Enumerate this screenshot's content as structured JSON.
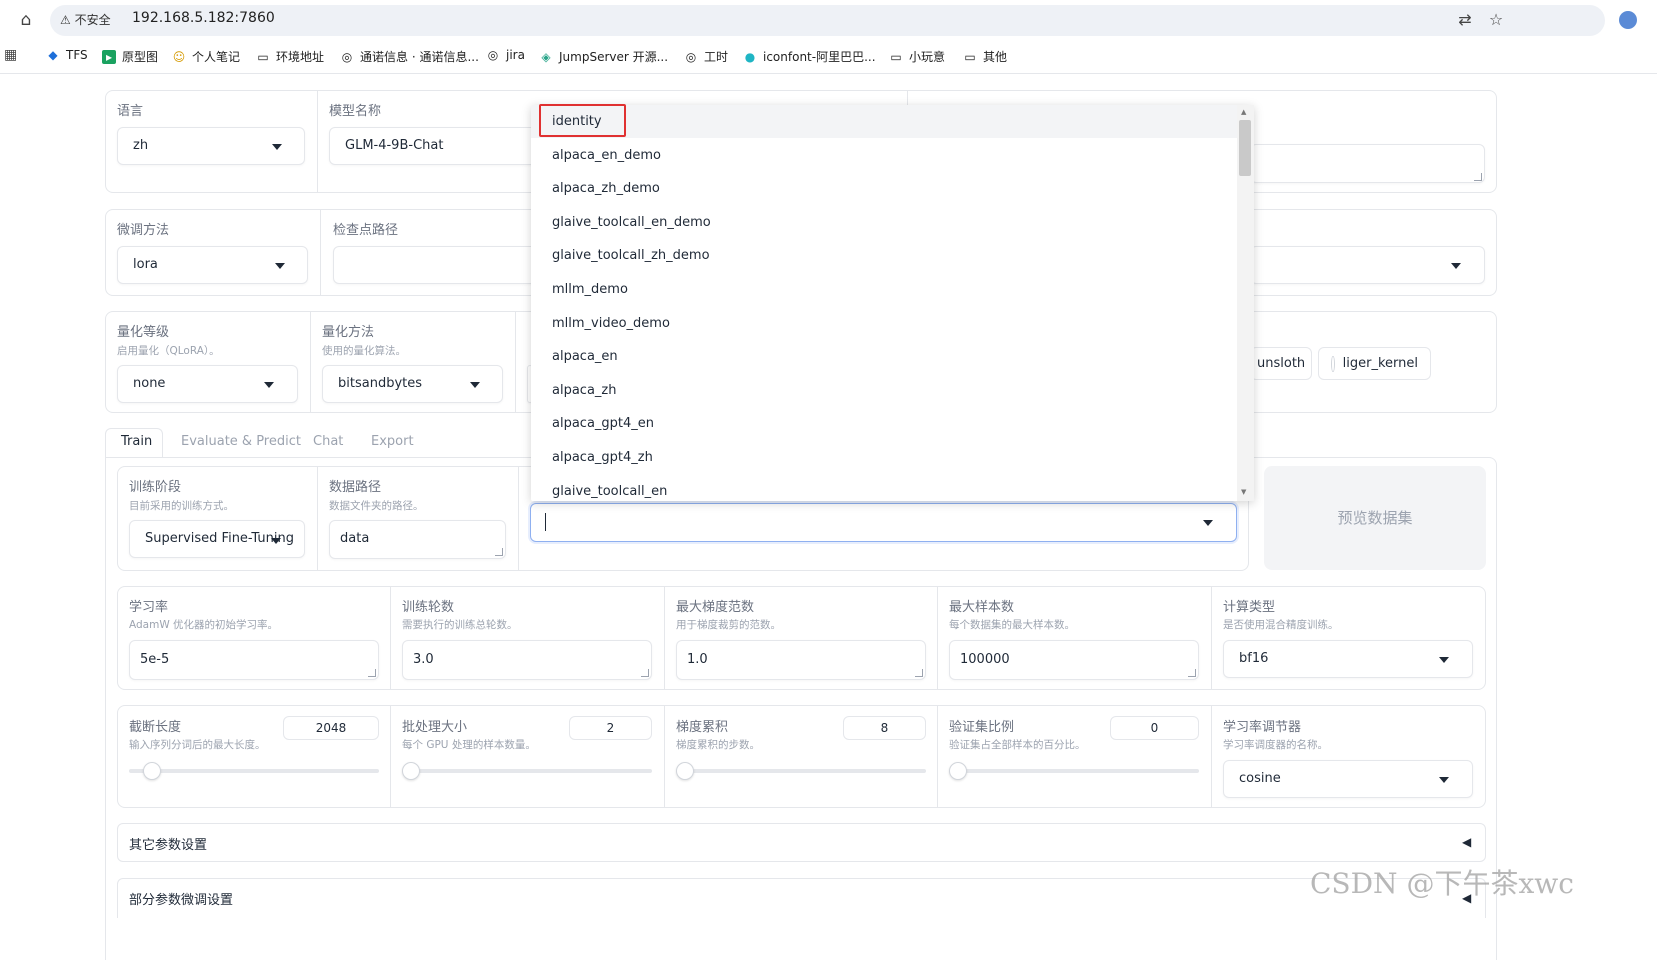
{
  "browser": {
    "insecure_label": "不安全",
    "url": "192.168.5.182:7860",
    "bookmarks": [
      {
        "label": "TFS",
        "icon": "azure-devops-icon"
      },
      {
        "label": "原型图",
        "icon": "axure-icon"
      },
      {
        "label": "个人笔记",
        "icon": "smiley-icon"
      },
      {
        "label": "环境地址",
        "icon": "folder-icon"
      },
      {
        "label": "通诺信息 · 通诺信息...",
        "icon": "globe-icon"
      },
      {
        "label": "jira",
        "icon": "globe-icon"
      },
      {
        "label": "JumpServer 开源...",
        "icon": "jumpserver-icon"
      },
      {
        "label": "工时",
        "icon": "globe-icon"
      },
      {
        "label": "iconfont-阿里巴巴...",
        "icon": "iconfont-icon"
      },
      {
        "label": "小玩意",
        "icon": "folder-icon"
      },
      {
        "label": "其他",
        "icon": "folder-icon"
      }
    ]
  },
  "top": {
    "language_label": "语言",
    "language_value": "zh",
    "model_name_label": "模型名称",
    "model_name_value": "GLM-4-9B-Chat",
    "finetune_label": "微调方法",
    "finetune_value": "lora",
    "checkpoint_label": "检查点路径",
    "quant_bit_label": "量化等级",
    "quant_bit_info": "启用量化（QLoRA）。",
    "quant_bit_value": "none",
    "quant_method_label": "量化方法",
    "quant_method_info": "使用的量化算法。",
    "quant_method_value": "bitsandbytes",
    "booster_unsloth": "unsloth",
    "booster_liger": "liger_kernel"
  },
  "tabs": [
    "Train",
    "Evaluate & Predict",
    "Chat",
    "Export"
  ],
  "train": {
    "stage_label": "训练阶段",
    "stage_info": "目前采用的训练方式。",
    "stage_value": "Supervised Fine-Tuning",
    "data_dir_label": "数据路径",
    "data_dir_info": "数据文件夹的路径。",
    "data_dir_value": "data",
    "preview_button": "预览数据集",
    "row1": [
      {
        "label": "学习率",
        "info": "AdamW 优化器的初始学习率。",
        "value": "5e-5"
      },
      {
        "label": "训练轮数",
        "info": "需要执行的训练总轮数。",
        "value": "3.0"
      },
      {
        "label": "最大梯度范数",
        "info": "用于梯度裁剪的范数。",
        "value": "1.0"
      },
      {
        "label": "最大样本数",
        "info": "每个数据集的最大样本数。",
        "value": "100000"
      },
      {
        "label": "计算类型",
        "info": "是否使用混合精度训练。",
        "value": "bf16"
      }
    ],
    "row2": [
      {
        "label": "截断长度",
        "info": "输入序列分词后的最大长度。",
        "value": "2048",
        "fraction": 0.06
      },
      {
        "label": "批处理大小",
        "info": "每个 GPU 处理的样本数量。",
        "value": "2",
        "fraction": 0.0
      },
      {
        "label": "梯度累积",
        "info": "梯度累积的步数。",
        "value": "8",
        "fraction": 0.0
      },
      {
        "label": "验证集比例",
        "info": "验证集占全部样本的百分比。",
        "value": "0",
        "fraction": 0.0
      }
    ],
    "scheduler_label": "学习率调节器",
    "scheduler_info": "学习率调度器的名称。",
    "scheduler_value": "cosine",
    "accordion1": "其它参数设置",
    "accordion2": "部分参数微调设置"
  },
  "dataset_dropdown": {
    "options": [
      "identity",
      "alpaca_en_demo",
      "alpaca_zh_demo",
      "glaive_toolcall_en_demo",
      "glaive_toolcall_zh_demo",
      "mllm_demo",
      "mllm_video_demo",
      "alpaca_en",
      "alpaca_zh",
      "alpaca_gpt4_en",
      "alpaca_gpt4_zh",
      "glaive_toolcall_en"
    ],
    "selected": "identity",
    "input_value": ""
  },
  "watermark": "CSDN @下午茶xwc"
}
